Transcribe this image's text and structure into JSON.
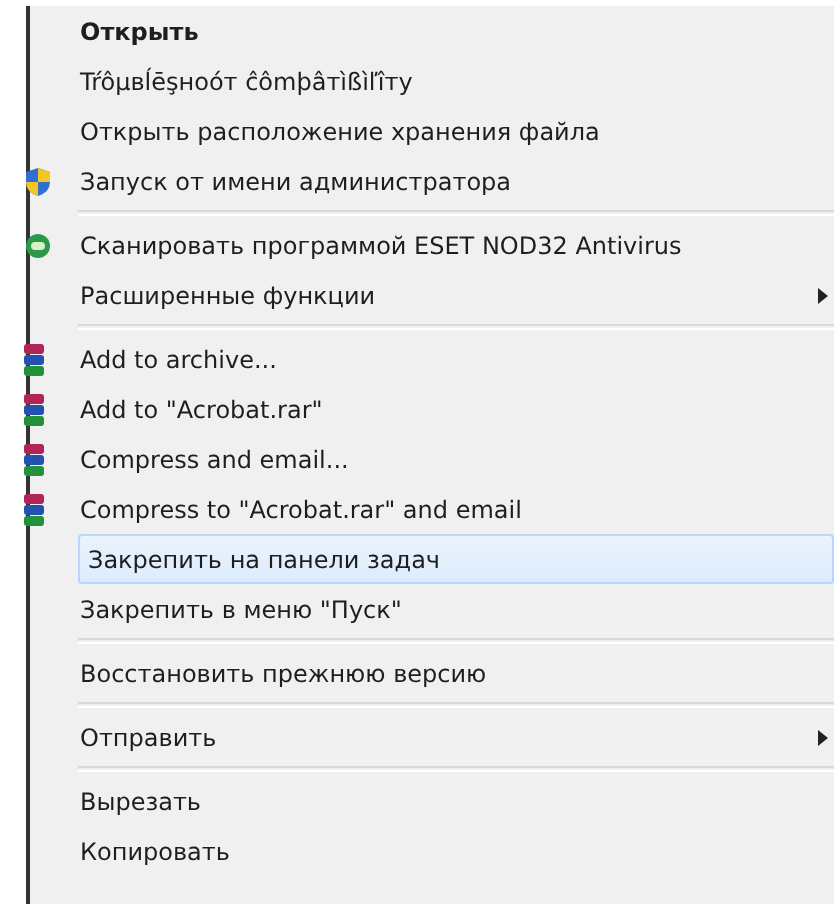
{
  "menu": {
    "items": [
      {
        "kind": "item",
        "label": "Открыть",
        "bold": true,
        "selected": false
      },
      {
        "kind": "item",
        "label": "Tŕôµвĺēşнoóт ĉômþâтìßìľîтy",
        "selected": false
      },
      {
        "kind": "item",
        "label": "Открыть расположение хранения файла",
        "selected": false
      },
      {
        "kind": "shield_item",
        "label": "Запуск от имени администратора",
        "selected": false
      },
      {
        "kind": "separator"
      },
      {
        "kind": "scan_item",
        "label": "Сканировать программой ESET NOD32 Antivirus",
        "selected": false
      },
      {
        "kind": "item",
        "label": "Расширенные функции",
        "submenu": true,
        "selected": false
      },
      {
        "kind": "separator"
      },
      {
        "kind": "archive_item",
        "label": "Add to archive...",
        "selected": false
      },
      {
        "kind": "archive_item",
        "label": "Add to \"Acrobat.rar\"",
        "selected": false
      },
      {
        "kind": "archive_item",
        "label": "Compress and email...",
        "selected": false
      },
      {
        "kind": "archive_item",
        "label": "Compress to \"Acrobat.rar\" and email",
        "selected": false
      },
      {
        "kind": "item",
        "label": "Закрепить на панели задач",
        "selected": true
      },
      {
        "kind": "item",
        "label": "Закрепить в меню \"Пуск\"",
        "selected": false
      },
      {
        "kind": "separator"
      },
      {
        "kind": "item",
        "label": "Восстановить прежнюю версию",
        "selected": false
      },
      {
        "kind": "separator"
      },
      {
        "kind": "item",
        "label": "Отправить",
        "submenu": true,
        "selected": false
      },
      {
        "kind": "separator"
      },
      {
        "kind": "item",
        "label": "Вырезать",
        "selected": false
      },
      {
        "kind": "item",
        "label": "Копировать",
        "selected": false
      }
    ]
  }
}
